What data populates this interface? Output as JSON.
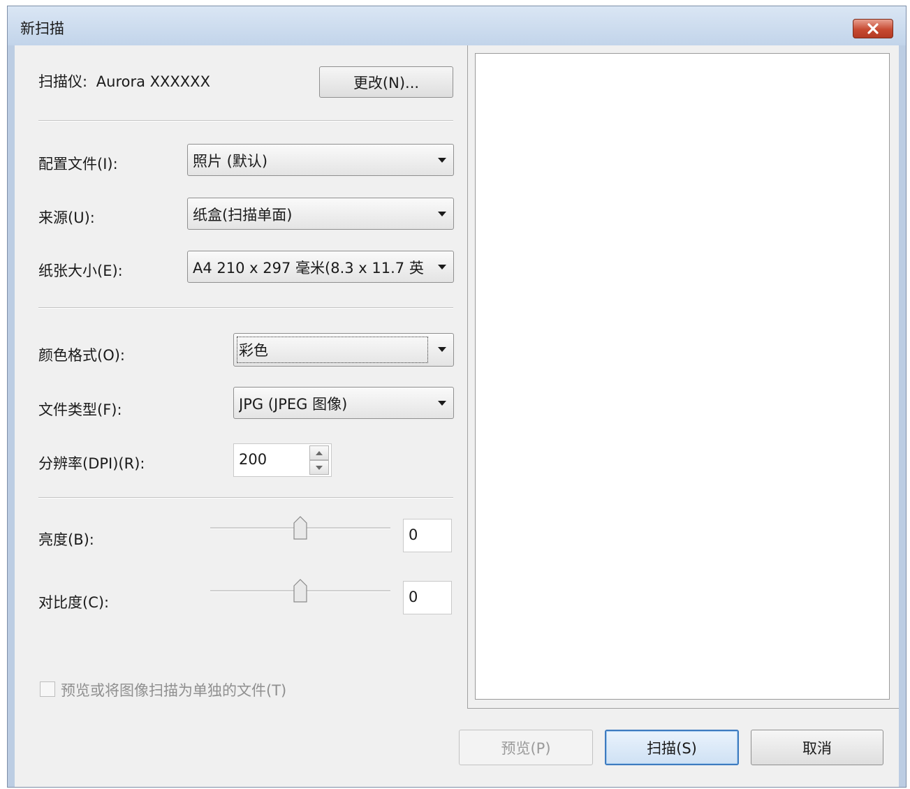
{
  "window": {
    "title": "新扫描"
  },
  "scanner": {
    "label": "扫描仪:",
    "name": "Aurora XXXXXX",
    "change_button": "更改(N)..."
  },
  "fields": {
    "profile": {
      "label": "配置文件(I):",
      "value": "照片 (默认)"
    },
    "source": {
      "label": "来源(U):",
      "value": "纸盒(扫描单面)"
    },
    "paper_size": {
      "label": "纸张大小(E):",
      "value": "A4 210 x 297 毫米(8.3 x 11.7 英"
    },
    "color_format": {
      "label": "颜色格式(O):",
      "value": "彩色"
    },
    "file_type": {
      "label": "文件类型(F):",
      "value": "JPG (JPEG 图像)"
    },
    "resolution": {
      "label": "分辨率(DPI)(R):",
      "value": "200"
    },
    "brightness": {
      "label": "亮度(B):",
      "value": "0",
      "level": 0.5
    },
    "contrast": {
      "label": "对比度(C):",
      "value": "0",
      "level": 0.5
    }
  },
  "separate_files": {
    "label": "预览或将图像扫描为单独的文件(T)",
    "checked": false,
    "enabled": false
  },
  "buttons": {
    "preview": "预览(P)",
    "scan": "扫描(S)",
    "cancel": "取消"
  },
  "icons": {
    "close": "close-icon",
    "dropdown": "chevron-down-icon",
    "spin_up": "spin-up-icon",
    "spin_down": "spin-down-icon",
    "slider_thumb": "slider-thumb-icon"
  }
}
